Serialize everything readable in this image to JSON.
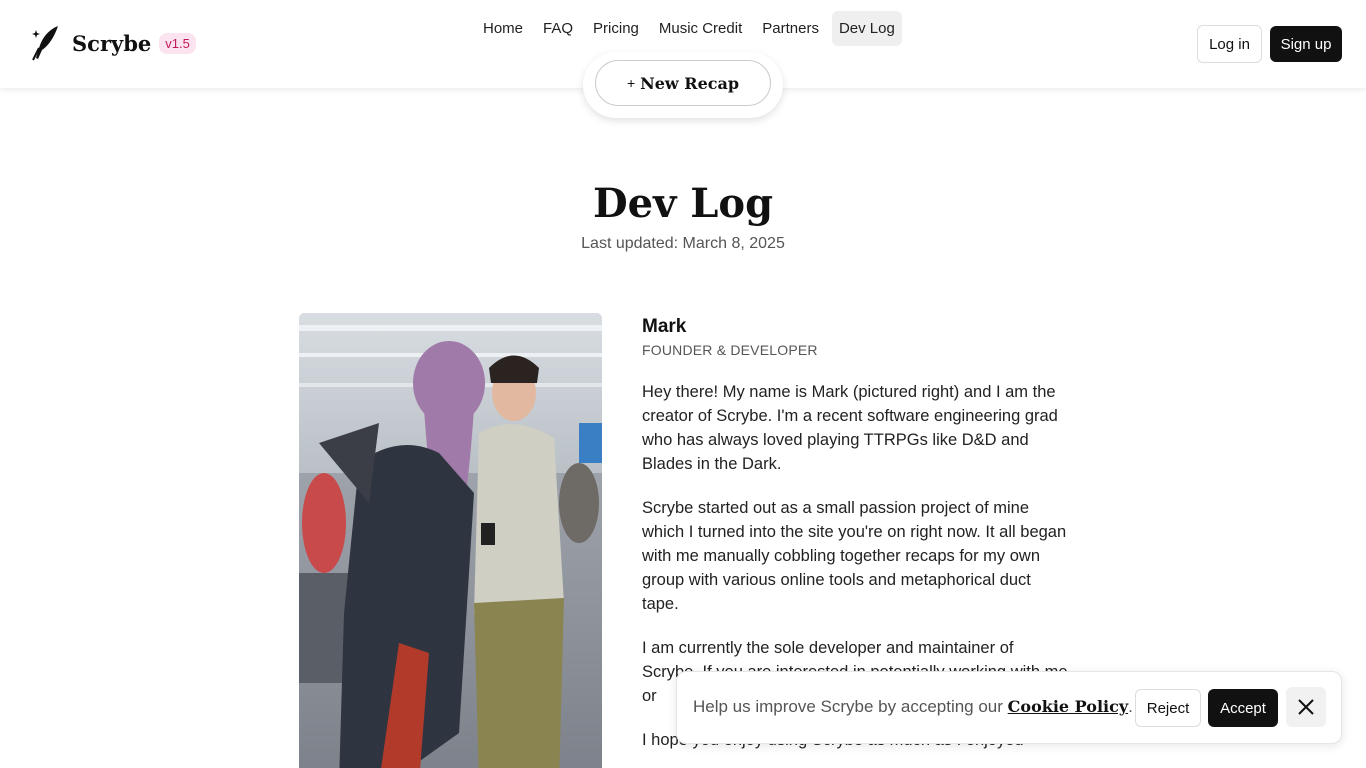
{
  "header": {
    "brand": "Scrybe",
    "version": "v1.5",
    "nav": [
      {
        "label": "Home"
      },
      {
        "label": "FAQ"
      },
      {
        "label": "Pricing"
      },
      {
        "label": "Music Credit"
      },
      {
        "label": "Partners"
      },
      {
        "label": "Dev Log",
        "active": true
      }
    ],
    "login_label": "Log in",
    "signup_label": "Sign up",
    "new_recap_plus": "+",
    "new_recap_label": "New Recap"
  },
  "page": {
    "title": "Dev Log",
    "updated": "Last updated: March 8, 2025"
  },
  "profile": {
    "name": "Mark",
    "role": "FOUNDER & DEVELOPER",
    "paragraphs": [
      "Hey there! My name is Mark (pictured right) and I am the creator of Scrybe. I'm a recent software engineering grad who has always loved playing TTRPGs like D&D and Blades in the Dark.",
      "Scrybe started out as a small passion project of mine which I turned into the site you're on right now. It all began with me manually cobbling together recaps for my own group with various online tools and metaphorical duct tape.",
      "I am currently the sole developer and maintainer of Scrybe. If you are interested in potentially working with me or",
      "I hope you enjoy using Scrybe as much as I enjoyed"
    ]
  },
  "cookie": {
    "text": "Help us improve Scrybe by accepting our",
    "link": "Cookie Policy",
    "period": ".",
    "reject_label": "Reject",
    "accept_label": "Accept"
  },
  "icons": {
    "logo": "quill-icon",
    "close": "close-icon"
  },
  "colors": {
    "version_bg": "#fbe4ef",
    "version_text": "#c2185b",
    "primary_button": "#111111"
  }
}
